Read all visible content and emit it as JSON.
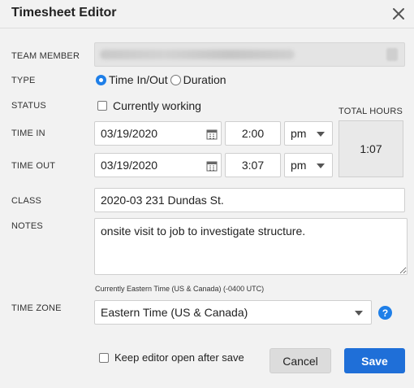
{
  "window": {
    "title": "Timesheet Editor"
  },
  "labels": {
    "team_member": "TEAM MEMBER",
    "type": "TYPE",
    "status": "STATUS",
    "time_in": "TIME IN",
    "time_out": "TIME OUT",
    "class": "CLASS",
    "notes": "NOTES",
    "time_zone": "TIME ZONE",
    "total_hours": "TOTAL HOURS"
  },
  "type_options": {
    "time_in_out": "Time In/Out",
    "duration": "Duration",
    "selected": "Time In/Out"
  },
  "status": {
    "currently_working_label": "Currently working",
    "currently_working_checked": false
  },
  "time_in": {
    "date": "03/19/2020",
    "time": "2:00",
    "ampm": "pm"
  },
  "time_out": {
    "date": "03/19/2020",
    "time": "3:07",
    "ampm": "pm"
  },
  "total_hours": "1:07",
  "class_value": "2020-03 231 Dundas St.",
  "notes_value": "onsite visit to job to investigate structure.",
  "time_zone": {
    "current_note": "Currently Eastern Time (US & Canada) (-0400 UTC)",
    "selected": "Eastern Time (US & Canada)",
    "help_symbol": "?"
  },
  "footer": {
    "keep_open_label": "Keep editor open after save",
    "cancel_label": "Cancel",
    "save_label": "Save"
  },
  "colors": {
    "accent": "#1f7fe8",
    "save_button": "#1f6fd8",
    "background": "#f2f2f2"
  },
  "icons": {
    "close": "close-icon",
    "calendar": "calendar-icon",
    "help": "help-icon",
    "dropdown": "chevron-down-icon"
  }
}
